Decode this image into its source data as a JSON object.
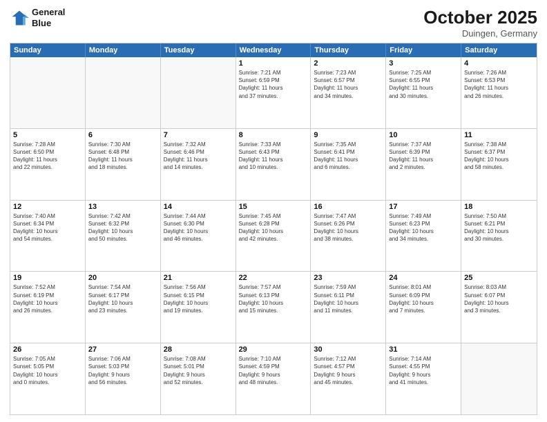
{
  "header": {
    "logo_line1": "General",
    "logo_line2": "Blue",
    "month_title": "October 2025",
    "location": "Duingen, Germany"
  },
  "weekdays": [
    "Sunday",
    "Monday",
    "Tuesday",
    "Wednesday",
    "Thursday",
    "Friday",
    "Saturday"
  ],
  "rows": [
    [
      {
        "day": "",
        "empty": true
      },
      {
        "day": "",
        "empty": true
      },
      {
        "day": "",
        "empty": true
      },
      {
        "day": "1",
        "line1": "Sunrise: 7:21 AM",
        "line2": "Sunset: 6:59 PM",
        "line3": "Daylight: 11 hours",
        "line4": "and 37 minutes."
      },
      {
        "day": "2",
        "line1": "Sunrise: 7:23 AM",
        "line2": "Sunset: 6:57 PM",
        "line3": "Daylight: 11 hours",
        "line4": "and 34 minutes."
      },
      {
        "day": "3",
        "line1": "Sunrise: 7:25 AM",
        "line2": "Sunset: 6:55 PM",
        "line3": "Daylight: 11 hours",
        "line4": "and 30 minutes."
      },
      {
        "day": "4",
        "line1": "Sunrise: 7:26 AM",
        "line2": "Sunset: 6:53 PM",
        "line3": "Daylight: 11 hours",
        "line4": "and 26 minutes."
      }
    ],
    [
      {
        "day": "5",
        "line1": "Sunrise: 7:28 AM",
        "line2": "Sunset: 6:50 PM",
        "line3": "Daylight: 11 hours",
        "line4": "and 22 minutes."
      },
      {
        "day": "6",
        "line1": "Sunrise: 7:30 AM",
        "line2": "Sunset: 6:48 PM",
        "line3": "Daylight: 11 hours",
        "line4": "and 18 minutes."
      },
      {
        "day": "7",
        "line1": "Sunrise: 7:32 AM",
        "line2": "Sunset: 6:46 PM",
        "line3": "Daylight: 11 hours",
        "line4": "and 14 minutes."
      },
      {
        "day": "8",
        "line1": "Sunrise: 7:33 AM",
        "line2": "Sunset: 6:43 PM",
        "line3": "Daylight: 11 hours",
        "line4": "and 10 minutes."
      },
      {
        "day": "9",
        "line1": "Sunrise: 7:35 AM",
        "line2": "Sunset: 6:41 PM",
        "line3": "Daylight: 11 hours",
        "line4": "and 6 minutes."
      },
      {
        "day": "10",
        "line1": "Sunrise: 7:37 AM",
        "line2": "Sunset: 6:39 PM",
        "line3": "Daylight: 11 hours",
        "line4": "and 2 minutes."
      },
      {
        "day": "11",
        "line1": "Sunrise: 7:38 AM",
        "line2": "Sunset: 6:37 PM",
        "line3": "Daylight: 10 hours",
        "line4": "and 58 minutes."
      }
    ],
    [
      {
        "day": "12",
        "line1": "Sunrise: 7:40 AM",
        "line2": "Sunset: 6:34 PM",
        "line3": "Daylight: 10 hours",
        "line4": "and 54 minutes."
      },
      {
        "day": "13",
        "line1": "Sunrise: 7:42 AM",
        "line2": "Sunset: 6:32 PM",
        "line3": "Daylight: 10 hours",
        "line4": "and 50 minutes."
      },
      {
        "day": "14",
        "line1": "Sunrise: 7:44 AM",
        "line2": "Sunset: 6:30 PM",
        "line3": "Daylight: 10 hours",
        "line4": "and 46 minutes."
      },
      {
        "day": "15",
        "line1": "Sunrise: 7:45 AM",
        "line2": "Sunset: 6:28 PM",
        "line3": "Daylight: 10 hours",
        "line4": "and 42 minutes."
      },
      {
        "day": "16",
        "line1": "Sunrise: 7:47 AM",
        "line2": "Sunset: 6:26 PM",
        "line3": "Daylight: 10 hours",
        "line4": "and 38 minutes."
      },
      {
        "day": "17",
        "line1": "Sunrise: 7:49 AM",
        "line2": "Sunset: 6:23 PM",
        "line3": "Daylight: 10 hours",
        "line4": "and 34 minutes."
      },
      {
        "day": "18",
        "line1": "Sunrise: 7:50 AM",
        "line2": "Sunset: 6:21 PM",
        "line3": "Daylight: 10 hours",
        "line4": "and 30 minutes."
      }
    ],
    [
      {
        "day": "19",
        "line1": "Sunrise: 7:52 AM",
        "line2": "Sunset: 6:19 PM",
        "line3": "Daylight: 10 hours",
        "line4": "and 26 minutes."
      },
      {
        "day": "20",
        "line1": "Sunrise: 7:54 AM",
        "line2": "Sunset: 6:17 PM",
        "line3": "Daylight: 10 hours",
        "line4": "and 23 minutes."
      },
      {
        "day": "21",
        "line1": "Sunrise: 7:56 AM",
        "line2": "Sunset: 6:15 PM",
        "line3": "Daylight: 10 hours",
        "line4": "and 19 minutes."
      },
      {
        "day": "22",
        "line1": "Sunrise: 7:57 AM",
        "line2": "Sunset: 6:13 PM",
        "line3": "Daylight: 10 hours",
        "line4": "and 15 minutes."
      },
      {
        "day": "23",
        "line1": "Sunrise: 7:59 AM",
        "line2": "Sunset: 6:11 PM",
        "line3": "Daylight: 10 hours",
        "line4": "and 11 minutes."
      },
      {
        "day": "24",
        "line1": "Sunrise: 8:01 AM",
        "line2": "Sunset: 6:09 PM",
        "line3": "Daylight: 10 hours",
        "line4": "and 7 minutes."
      },
      {
        "day": "25",
        "line1": "Sunrise: 8:03 AM",
        "line2": "Sunset: 6:07 PM",
        "line3": "Daylight: 10 hours",
        "line4": "and 3 minutes."
      }
    ],
    [
      {
        "day": "26",
        "line1": "Sunrise: 7:05 AM",
        "line2": "Sunset: 5:05 PM",
        "line3": "Daylight: 10 hours",
        "line4": "and 0 minutes."
      },
      {
        "day": "27",
        "line1": "Sunrise: 7:06 AM",
        "line2": "Sunset: 5:03 PM",
        "line3": "Daylight: 9 hours",
        "line4": "and 56 minutes."
      },
      {
        "day": "28",
        "line1": "Sunrise: 7:08 AM",
        "line2": "Sunset: 5:01 PM",
        "line3": "Daylight: 9 hours",
        "line4": "and 52 minutes."
      },
      {
        "day": "29",
        "line1": "Sunrise: 7:10 AM",
        "line2": "Sunset: 4:59 PM",
        "line3": "Daylight: 9 hours",
        "line4": "and 48 minutes."
      },
      {
        "day": "30",
        "line1": "Sunrise: 7:12 AM",
        "line2": "Sunset: 4:57 PM",
        "line3": "Daylight: 9 hours",
        "line4": "and 45 minutes."
      },
      {
        "day": "31",
        "line1": "Sunrise: 7:14 AM",
        "line2": "Sunset: 4:55 PM",
        "line3": "Daylight: 9 hours",
        "line4": "and 41 minutes."
      },
      {
        "day": "",
        "empty": true
      }
    ]
  ]
}
